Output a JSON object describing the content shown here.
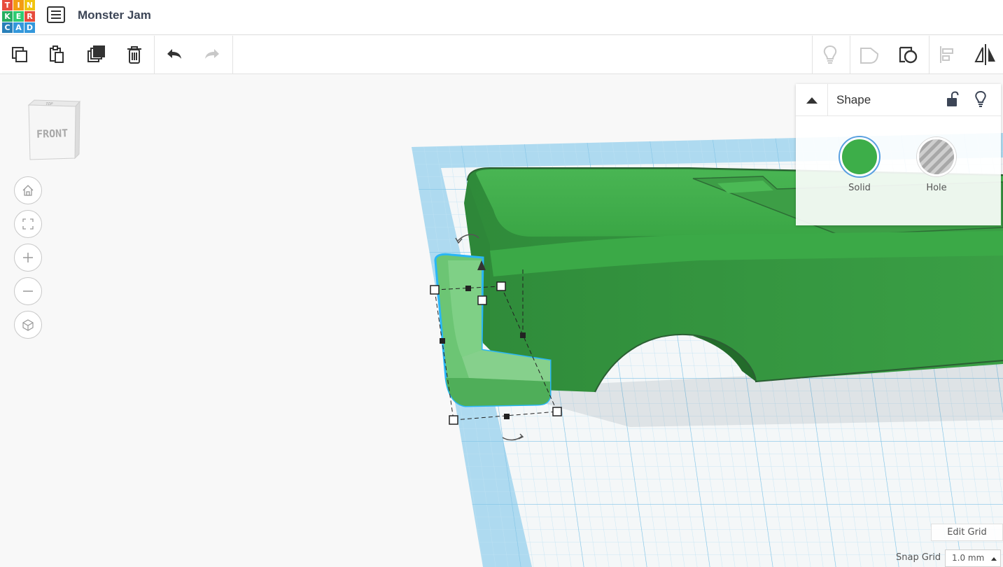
{
  "header": {
    "logo_letters": [
      "T",
      "I",
      "N",
      "K",
      "E",
      "R",
      "C",
      "A",
      "D"
    ],
    "logo_colors": [
      "#e74c3c",
      "#f39c12",
      "#f1c40f",
      "#27ae60",
      "#2ecc71",
      "#e74c3c",
      "#2980b9",
      "#3498db",
      "#3498db"
    ],
    "title": "Monster Jam"
  },
  "toolbar": {
    "left_tools": [
      {
        "name": "copy-button",
        "icon": "copy-icon"
      },
      {
        "name": "paste-button",
        "icon": "paste-icon"
      },
      {
        "name": "duplicate-button",
        "icon": "duplicate-icon"
      },
      {
        "name": "delete-button",
        "icon": "trash-icon"
      },
      {
        "name": "undo-button",
        "icon": "undo-icon"
      },
      {
        "name": "redo-button",
        "icon": "redo-icon"
      }
    ],
    "right_tools": [
      {
        "name": "show-all-button",
        "icon": "lightbulb-icon"
      },
      {
        "name": "group-button",
        "icon": "group-icon"
      },
      {
        "name": "ungroup-button",
        "icon": "ungroup-icon"
      },
      {
        "name": "align-button",
        "icon": "align-icon"
      },
      {
        "name": "mirror-button",
        "icon": "mirror-icon"
      }
    ]
  },
  "viewcube": {
    "front_label": "FRONT",
    "top_label": "TOP"
  },
  "nav": [
    "home-icon",
    "fit-view-icon",
    "zoom-in-icon",
    "zoom-out-icon",
    "perspective-icon"
  ],
  "shape_panel": {
    "title": "Shape",
    "options": [
      {
        "label": "Solid",
        "color": "#3dae49"
      },
      {
        "label": "Hole",
        "color": "#b8b8b8"
      }
    ]
  },
  "grid": {
    "edit_label": "Edit Grid",
    "snap_label": "Snap Grid",
    "snap_value": "1.0 mm"
  },
  "colors": {
    "model_green": "#3dae49",
    "model_dark": "#2f8b3a",
    "grid_blue": "#9fd2ec",
    "selection_blue": "#29b6f6"
  }
}
